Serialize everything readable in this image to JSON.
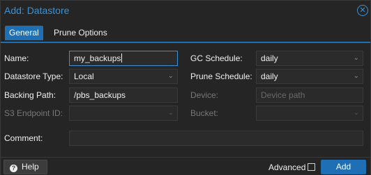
{
  "dialog": {
    "title": "Add: Datastore",
    "close_icon": "x-circle-icon"
  },
  "tabs": [
    {
      "label": "General",
      "active": true
    },
    {
      "label": "Prune Options",
      "active": false
    }
  ],
  "form": {
    "name": {
      "label": "Name:",
      "value": "my_backups"
    },
    "datastore_type": {
      "label": "Datastore Type:",
      "value": "Local"
    },
    "backing_path": {
      "label": "Backing Path:",
      "value": "/pbs_backups"
    },
    "s3_endpoint": {
      "label": "S3 Endpoint ID:",
      "value": ""
    },
    "gc_schedule": {
      "label": "GC Schedule:",
      "value": "daily"
    },
    "prune_schedule": {
      "label": "Prune Schedule:",
      "value": "daily"
    },
    "device": {
      "label": "Device:",
      "placeholder": "Device path"
    },
    "bucket": {
      "label": "Bucket:",
      "value": ""
    },
    "comment": {
      "label": "Comment:",
      "value": ""
    }
  },
  "footer": {
    "help_label": "Help",
    "advanced_label": "Advanced",
    "advanced_checked": false,
    "add_label": "Add"
  },
  "colors": {
    "accent": "#1f6fb5",
    "title": "#3a92d6",
    "background": "#252526"
  }
}
